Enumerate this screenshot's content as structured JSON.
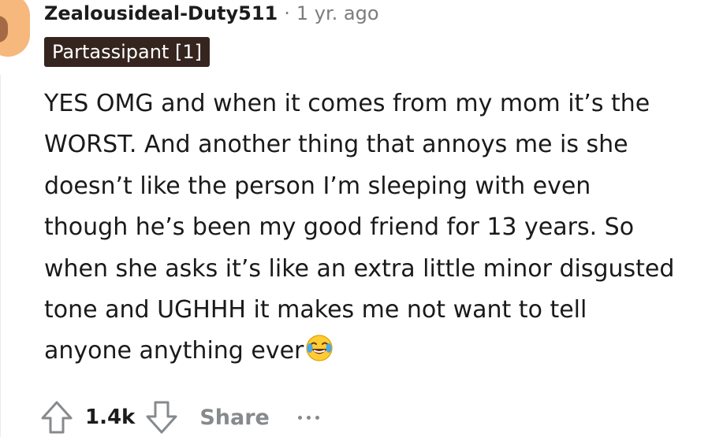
{
  "comment": {
    "author": "Zealousideal-Duty511",
    "separator": "·",
    "time": "1 yr. ago",
    "flair": "Partassipant [1]",
    "body_lines": [
      "YES OMG and when it comes from my mom it’s the",
      "WORST. And another thing that annoys me is she",
      "doesn’t like the person I’m sleeping with even",
      "though he’s been my good friend for 13 years. So",
      "when she asks it’s like an extra little minor disgusted",
      "tone and UGHHH it makes me not want to tell",
      "anyone anything ever"
    ],
    "emoji": "face-with-tears-of-joy-icon"
  },
  "actions": {
    "score": "1.4k",
    "share_label": "Share"
  }
}
